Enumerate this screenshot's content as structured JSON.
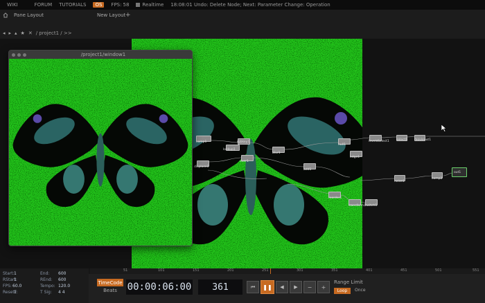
{
  "menu": {
    "items": [
      "WIKI",
      "FORUM",
      "TUTORIALS"
    ],
    "fps_badge": "OS",
    "fps_label": "FPS:",
    "fps_value": "58",
    "realtime_label": "Realtime",
    "status": "18:08:01 Undo: Delete Node; Next: Parameter Change: Operation"
  },
  "panes": {
    "pane_layout": "Pane Layout",
    "new_layout": "New Layout",
    "add": "+"
  },
  "path": {
    "text": "/ project1 / >>"
  },
  "window": {
    "title": "/project1/window1"
  },
  "nodes": [
    {
      "label": "comp1"
    },
    {
      "label": "rgbkey1"
    },
    {
      "label": "lookup1"
    },
    {
      "label": "blur1"
    },
    {
      "label": "null1"
    },
    {
      "label": "displace1"
    },
    {
      "label": "over1"
    },
    {
      "label": "levelsSelect1"
    },
    {
      "label": "select1"
    },
    {
      "label": "movieout1"
    },
    {
      "label": "edge1"
    },
    {
      "label": "add1"
    },
    {
      "label": "noise1"
    },
    {
      "label": "comp2"
    },
    {
      "label": "out1"
    },
    {
      "label": "reorder1"
    },
    {
      "label": "transform1"
    },
    {
      "label": "switch1"
    }
  ],
  "timeline": {
    "ruler": [
      "1",
      "51",
      "101",
      "151",
      "201",
      "251",
      "301",
      "351",
      "401",
      "451",
      "501",
      "551"
    ],
    "info": {
      "start_label": "Start:",
      "start_value": "1",
      "end_label": "End:",
      "end_value": "600",
      "rstart_label": "RStart:",
      "rstart_value": "1",
      "rend_label": "REnd:",
      "rend_value": "600",
      "fps_label": "FPS:",
      "fps_value": "60.0",
      "tempo_label": "Tempo:",
      "tempo_value": "120.0",
      "resetf_label": "ResetF:",
      "resetf_value": "1",
      "tsig_label": "T Sig:",
      "tsig_value": "4  4"
    },
    "timecode_button": "TimeCode",
    "beats_button": "Beats",
    "timecode": "00:00:06:00",
    "frame": "361",
    "range_limit": "Range Limit",
    "loop": "Loop",
    "once": "Once"
  },
  "colors": {
    "accent_orange": "#c76a21",
    "green_screen": "#22c21a",
    "node_bg": "#8a8a8a"
  }
}
